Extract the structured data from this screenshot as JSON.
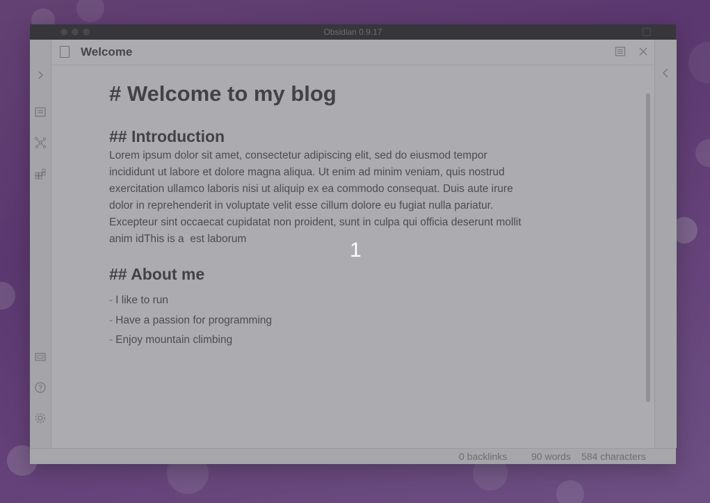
{
  "window": {
    "title": "Obsidian 0.9.17"
  },
  "ribbon": {
    "items": [
      {
        "icon": "chevron-right-icon"
      },
      {
        "icon": "file-explorer-icon"
      },
      {
        "icon": "graph-view-icon"
      },
      {
        "icon": "blocks-icon"
      },
      {
        "icon": "vault-icon"
      },
      {
        "icon": "help-icon"
      },
      {
        "icon": "settings-icon"
      }
    ]
  },
  "tab": {
    "title": "Welcome",
    "actions": [
      {
        "icon": "reading-view-icon"
      },
      {
        "icon": "close-icon"
      },
      {
        "icon": "more-options-icon"
      }
    ]
  },
  "document": {
    "h1": "# Welcome to my blog",
    "intro_heading": "## Introduction",
    "intro_lines": [
      "Lorem ipsum dolor sit amet, consectetur adipiscing elit, sed do eiusmod tempor",
      "incididunt ut labore et dolore magna aliqua. Ut enim ad minim veniam, quis nostrud",
      "exercitation ullamco laboris nisi ut aliquip ex ea commodo consequat. Duis aute irure",
      "dolor in reprehenderit in voluptate velit esse cillum dolore eu fugiat nulla pariatur.",
      "Excepteur sint occaecat cupidatat non proident, sunt in culpa qui officia deserunt mollit",
      "anim idThis is a  est laborum"
    ],
    "about_heading": "## About me",
    "about_items": [
      "I like to run",
      "Have a passion for programming",
      "Enjoy mountain climbing"
    ],
    "list_marker": "-"
  },
  "statusbar": {
    "backlinks": "0 backlinks",
    "words": "90 words",
    "characters": "584 characters"
  },
  "overlay": {
    "step_marker": "1"
  }
}
